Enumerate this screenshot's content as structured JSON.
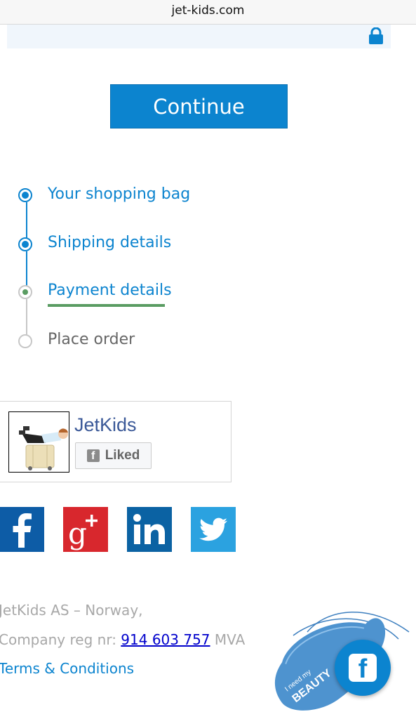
{
  "browser": {
    "url": "jet-kids.com"
  },
  "colors": {
    "primary": "#0c84cf",
    "active_step": "#5a9c62",
    "inactive": "#c7c7c7",
    "facebook_blue": "#3b5998"
  },
  "checkout": {
    "continue_label": "Continue"
  },
  "steps": [
    {
      "label": "Your shopping bag",
      "state": "completed"
    },
    {
      "label": "Shipping details",
      "state": "completed"
    },
    {
      "label": "Payment details",
      "state": "current"
    },
    {
      "label": "Place order",
      "state": "pending"
    }
  ],
  "fb_page": {
    "name": "JetKids",
    "liked_label": "Liked",
    "liked_icon": "facebook-f-icon",
    "avatar": "boy-riding-suitcase-photo"
  },
  "social_icons": [
    "facebook-icon",
    "google-plus-icon",
    "linkedin-icon",
    "twitter-icon"
  ],
  "footer": {
    "company_line": "JetKids AS – Norway,",
    "reg_prefix": "Company reg nr:",
    "reg_number": "914 603 757",
    "reg_suffix": "MVA",
    "terms_label": "Terms & Conditions"
  },
  "promo": {
    "mask_text_small": "I need my",
    "mask_text_big": "BEAUTY",
    "fb_button_icon": "facebook-f-icon"
  }
}
